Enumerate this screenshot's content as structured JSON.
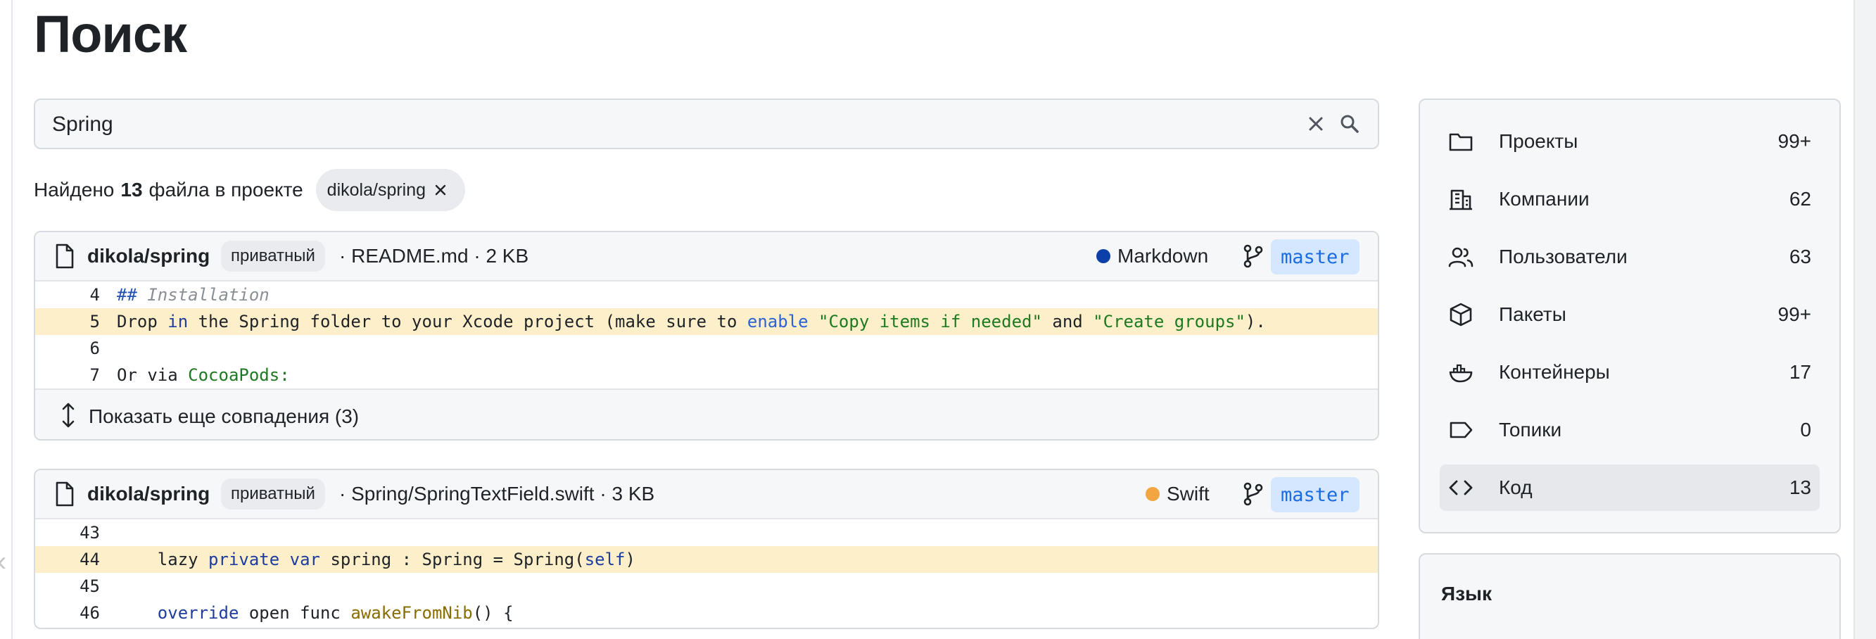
{
  "page": {
    "title": "Поиск"
  },
  "search": {
    "value": "Spring"
  },
  "summary": {
    "prefix": "Найдено",
    "count": "13",
    "suffix": "файла в проекте",
    "filter_chip": "dikola/spring"
  },
  "results": [
    {
      "repo": "dikola/spring",
      "visibility": "приватный",
      "path": "· README.md · 2 KB",
      "language": "Markdown",
      "language_color": "#0d3fa8",
      "branch": "master",
      "show_more": "Показать еще совпадения (3)",
      "lines": [
        {
          "num": "4",
          "highlighted": false,
          "tokens": [
            {
              "t": "##",
              "c": "hash"
            },
            {
              "t": " Installation",
              "c": ""
            }
          ],
          "style": "comment"
        },
        {
          "num": "5",
          "highlighted": true,
          "tokens": [
            {
              "t": "Drop ",
              "c": ""
            },
            {
              "t": "in",
              "c": "kw"
            },
            {
              "t": " the Spring folder to your Xcode project (make sure to ",
              "c": ""
            },
            {
              "t": "enable",
              "c": "kw2"
            },
            {
              "t": " ",
              "c": ""
            },
            {
              "t": "\"Copy items if needed\"",
              "c": "str"
            },
            {
              "t": " and ",
              "c": ""
            },
            {
              "t": "\"Create groups\"",
              "c": "str"
            },
            {
              "t": ").",
              "c": ""
            }
          ]
        },
        {
          "num": "6",
          "highlighted": false,
          "tokens": []
        },
        {
          "num": "7",
          "highlighted": false,
          "tokens": [
            {
              "t": "Or via ",
              "c": ""
            },
            {
              "t": "CocoaPods:",
              "c": "str"
            }
          ]
        }
      ]
    },
    {
      "repo": "dikola/spring",
      "visibility": "приватный",
      "path": "· Spring/SpringTextField.swift · 3 KB",
      "language": "Swift",
      "language_color": "#f2a541",
      "branch": "master",
      "lines": [
        {
          "num": "43",
          "highlighted": false,
          "tokens": []
        },
        {
          "num": "44",
          "highlighted": true,
          "tokens": [
            {
              "t": "    lazy ",
              "c": ""
            },
            {
              "t": "private",
              "c": "kw"
            },
            {
              "t": " ",
              "c": ""
            },
            {
              "t": "var",
              "c": "kw"
            },
            {
              "t": " spring : Spring = Spring(",
              "c": ""
            },
            {
              "t": "self",
              "c": "kw"
            },
            {
              "t": ")",
              "c": ""
            }
          ]
        },
        {
          "num": "45",
          "highlighted": false,
          "tokens": []
        },
        {
          "num": "46",
          "highlighted": false,
          "tokens": [
            {
              "t": "    ",
              "c": ""
            },
            {
              "t": "override",
              "c": "kw"
            },
            {
              "t": " open func ",
              "c": ""
            },
            {
              "t": "awakeFromNib",
              "c": "fn"
            },
            {
              "t": "() {",
              "c": ""
            }
          ]
        }
      ]
    }
  ],
  "sidebar": {
    "items": [
      {
        "label": "Проекты",
        "count": "99+",
        "icon": "folder-icon",
        "active": false
      },
      {
        "label": "Компании",
        "count": "62",
        "icon": "building-icon",
        "active": false
      },
      {
        "label": "Пользователи",
        "count": "63",
        "icon": "users-icon",
        "active": false
      },
      {
        "label": "Пакеты",
        "count": "99+",
        "icon": "package-icon",
        "active": false
      },
      {
        "label": "Контейнеры",
        "count": "17",
        "icon": "container-icon",
        "active": false
      },
      {
        "label": "Топики",
        "count": "0",
        "icon": "tag-icon",
        "active": false
      },
      {
        "label": "Код",
        "count": "13",
        "icon": "code-icon",
        "active": true
      }
    ],
    "language_filter_title": "Язык"
  }
}
